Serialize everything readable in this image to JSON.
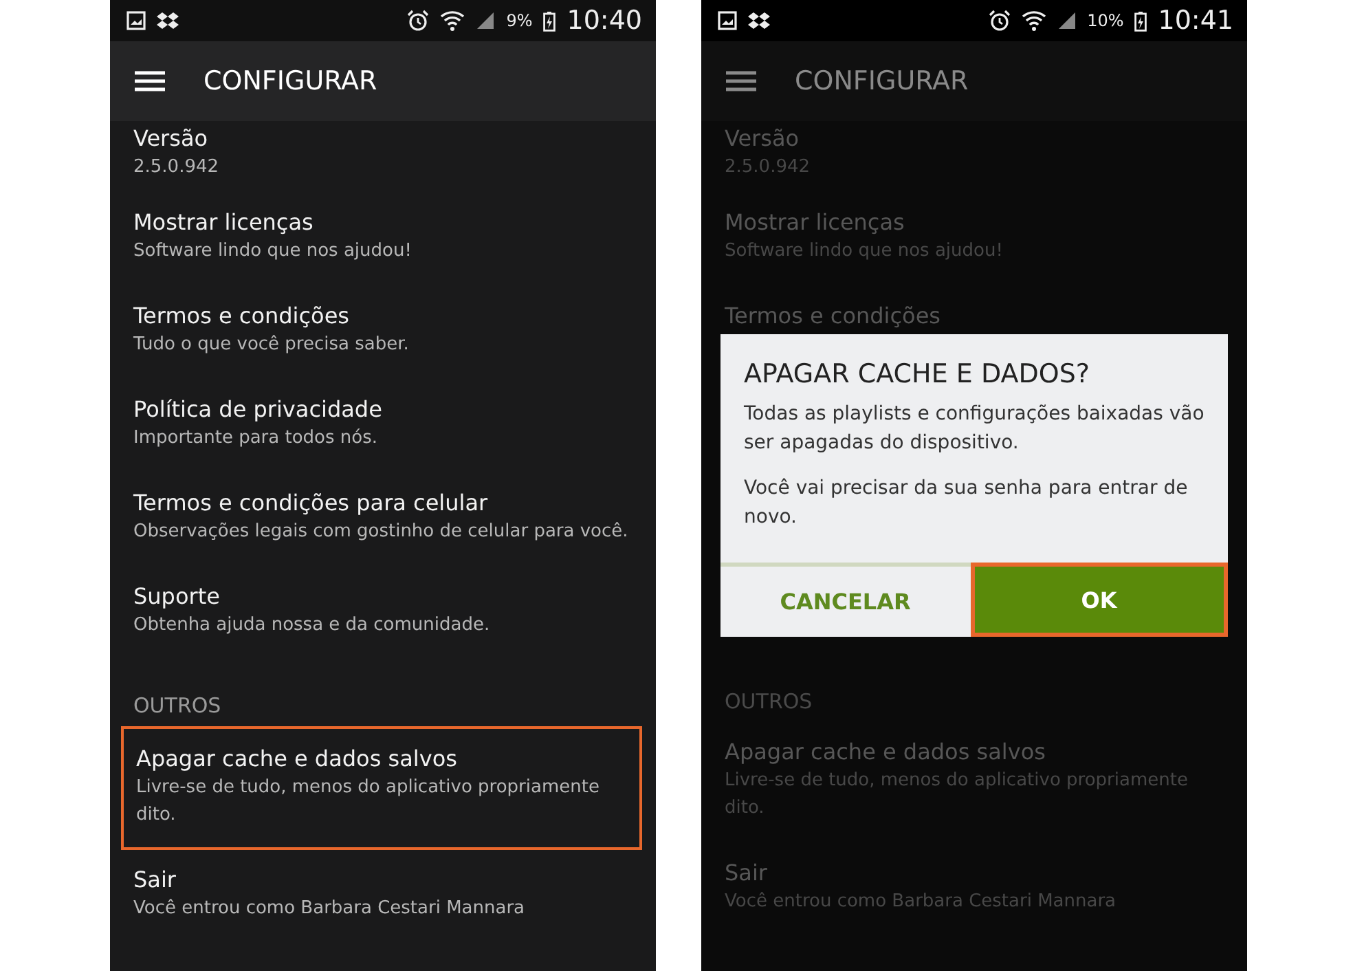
{
  "screens": [
    {
      "status_bar": {
        "battery": "9%",
        "time": "10:40"
      },
      "app_bar": {
        "title": "CONFIGURAR"
      },
      "dimmed": false,
      "rows": [
        {
          "kind": "item",
          "title": "Versão",
          "subtitle": "2.5.0.942",
          "highlighted": false
        },
        {
          "kind": "item",
          "title": "Mostrar licenças",
          "subtitle": "Software lindo que nos ajudou!",
          "highlighted": false
        },
        {
          "kind": "item",
          "title": "Termos e condições",
          "subtitle": "Tudo o que você precisa saber.",
          "highlighted": false
        },
        {
          "kind": "item",
          "title": "Política de privacidade",
          "subtitle": "Importante para todos nós.",
          "highlighted": false
        },
        {
          "kind": "item",
          "title": "Termos e condições para celular",
          "subtitle": "Observações legais com gostinho de celular para você.",
          "highlighted": false
        },
        {
          "kind": "item",
          "title": "Suporte",
          "subtitle": "Obtenha ajuda nossa e da comunidade.",
          "highlighted": false
        },
        {
          "kind": "header",
          "title": "OUTROS"
        },
        {
          "kind": "item",
          "title": "Apagar cache e dados salvos",
          "subtitle": "Livre-se de tudo, menos do aplicativo propriamente dito.",
          "highlighted": true
        },
        {
          "kind": "item",
          "title": "Sair",
          "subtitle": "Você entrou como Barbara Cestari Mannara",
          "highlighted": false
        }
      ]
    },
    {
      "status_bar": {
        "battery": "10%",
        "time": "10:41"
      },
      "app_bar": {
        "title": "CONFIGURAR"
      },
      "dimmed": true,
      "rows": [
        {
          "kind": "item",
          "title": "Versão",
          "subtitle": "2.5.0.942",
          "highlighted": false
        },
        {
          "kind": "item",
          "title": "Mostrar licenças",
          "subtitle": "Software lindo que nos ajudou!",
          "highlighted": false
        },
        {
          "kind": "item",
          "title": "Termos e condições",
          "highlighted": false
        },
        {
          "kind": "dialog",
          "title": "APAGAR CACHE E DADOS?",
          "paragraphs": [
            "Todas as playlists e configurações baixadas vão ser apagadas do dispositivo.",
            "Você vai precisar da sua senha para entrar de novo."
          ],
          "buttons": [
            {
              "label": "CANCELAR",
              "kind": "flat",
              "highlighted": false
            },
            {
              "label": "OK",
              "kind": "filled",
              "highlighted": true
            }
          ]
        },
        {
          "kind": "header",
          "title": "OUTROS"
        },
        {
          "kind": "item",
          "title": "Apagar cache e dados salvos",
          "subtitle": "Livre-se de tudo, menos do aplicativo propriamente dito.",
          "highlighted": false
        },
        {
          "kind": "item",
          "title": "Sair",
          "subtitle": "Você entrou como Barbara Cestari Mannara",
          "highlighted": false
        }
      ]
    }
  ]
}
